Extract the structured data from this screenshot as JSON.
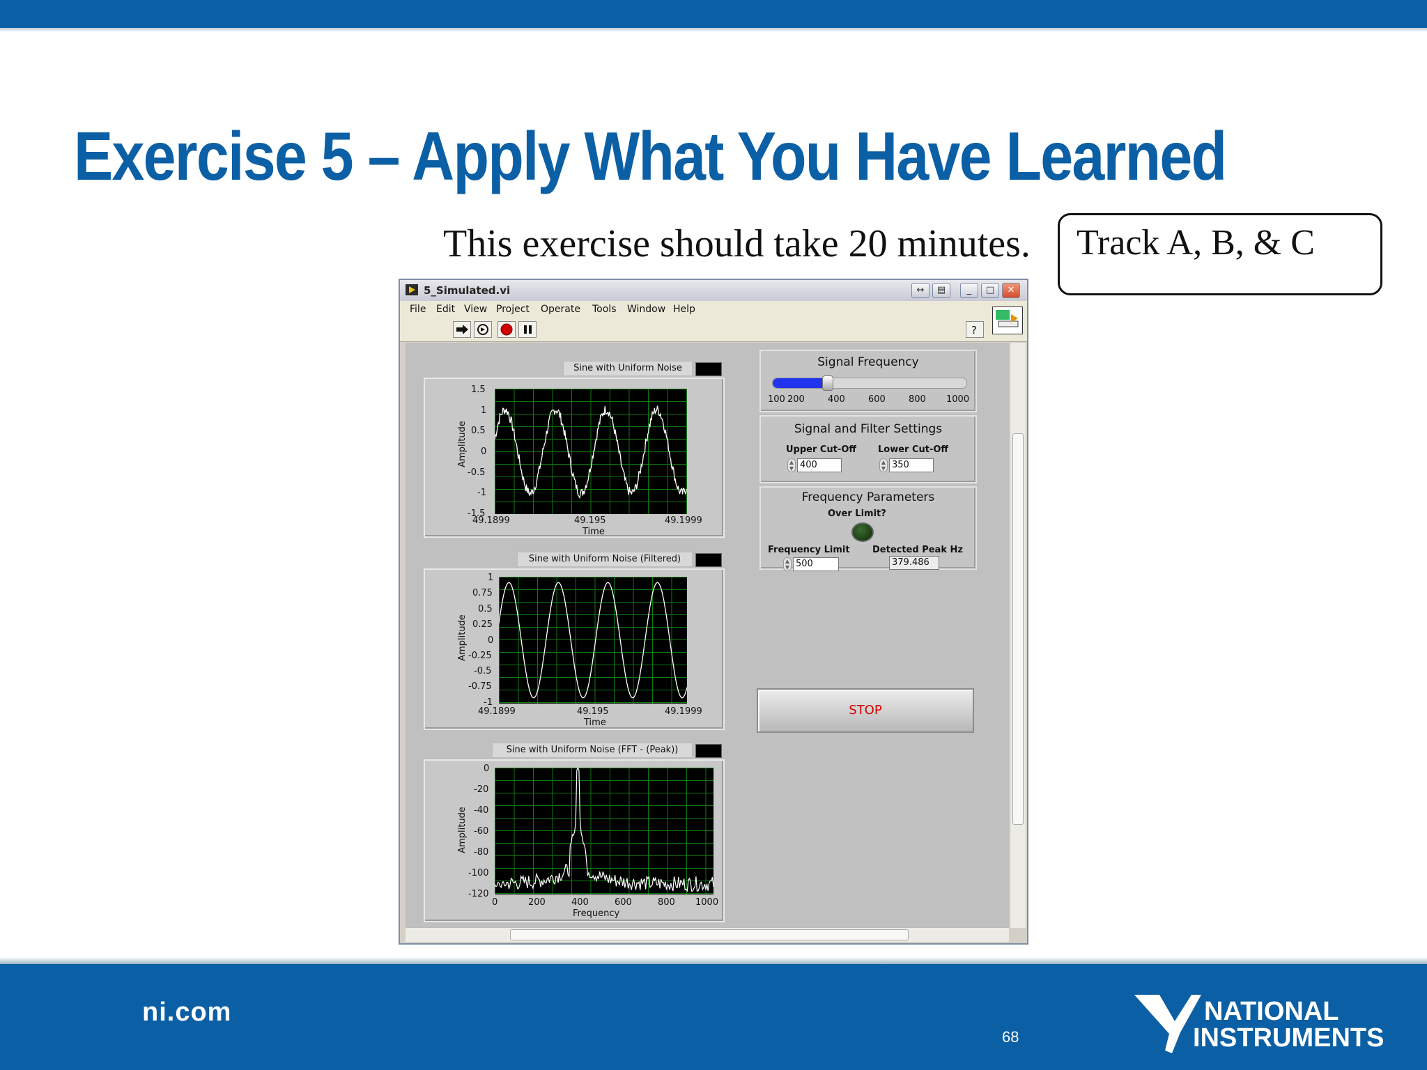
{
  "slide": {
    "title": "Exercise 5 – Apply What You Have Learned",
    "subtitle": "This exercise should take 20 minutes.",
    "track_badge": "Track A, B, & C",
    "footer_site": "ni.com",
    "page_number": "68",
    "logo_line1": "NATIONAL",
    "logo_line2": "INSTRUMENTS",
    "brand_color": "#0b5fa5"
  },
  "window": {
    "title": "5_Simulated.vi",
    "menu": [
      "File",
      "Edit",
      "View",
      "Project",
      "Operate",
      "Tools",
      "Window",
      "Help"
    ],
    "toolbar_icons": [
      "run-arrow-icon",
      "run-continuously-icon",
      "abort-icon",
      "pause-icon"
    ]
  },
  "graphs": {
    "g1": {
      "label": "Sine with Uniform Noise",
      "y_ticks": [
        "1.5",
        "1",
        "0.5",
        "0",
        "-0.5",
        "-1",
        "-1.5"
      ],
      "x_ticks": [
        "49.1899",
        "49.195",
        "49.1999"
      ],
      "xlabel": "Time",
      "ylabel": "Amplitude"
    },
    "g2": {
      "label": "Sine with Uniform Noise (Filtered)",
      "y_ticks": [
        "1",
        "0.75",
        "0.5",
        "0.25",
        "0",
        "-0.25",
        "-0.5",
        "-0.75",
        "-1"
      ],
      "x_ticks": [
        "49.1899",
        "49.195",
        "49.1999"
      ],
      "xlabel": "Time",
      "ylabel": "Amplitude"
    },
    "g3": {
      "label": "Sine with Uniform Noise (FFT - (Peak))",
      "y_ticks": [
        "0",
        "-20",
        "-40",
        "-60",
        "-80",
        "-100",
        "-120"
      ],
      "x_ticks": [
        "0",
        "200",
        "400",
        "600",
        "800",
        "1000"
      ],
      "xlabel": "Frequency",
      "ylabel": "Amplitude"
    }
  },
  "controls": {
    "signal_frequency": {
      "title": "Signal Frequency",
      "ticks": [
        "100",
        "200",
        "400",
        "600",
        "800",
        "1000"
      ],
      "value": 250
    },
    "filter": {
      "title": "Signal and Filter Settings",
      "upper_label": "Upper Cut-Off",
      "upper_value": "400",
      "lower_label": "Lower Cut-Off",
      "lower_value": "350"
    },
    "freq_params": {
      "title": "Frequency Parameters",
      "over_limit_label": "Over Limit?",
      "limit_label": "Frequency Limit",
      "limit_value": "500",
      "peak_label": "Detected Peak Hz",
      "peak_value": "379.486"
    },
    "stop_label": "STOP"
  },
  "chart_data": [
    {
      "type": "line",
      "title": "Sine with Uniform Noise",
      "xlabel": "Time",
      "ylabel": "Amplitude",
      "xlim": [
        49.1899,
        49.1999
      ],
      "ylim": [
        -1.5,
        1.5
      ],
      "series": [
        {
          "name": "Sine with Uniform Noise",
          "cycles": 3.8,
          "amplitude": 1.0,
          "noise": 0.12
        }
      ]
    },
    {
      "type": "line",
      "title": "Sine with Uniform Noise (Filtered)",
      "xlabel": "Time",
      "ylabel": "Amplitude",
      "xlim": [
        49.1899,
        49.1999
      ],
      "ylim": [
        -1,
        1
      ],
      "series": [
        {
          "name": "Sine with Uniform Noise (Filtered)",
          "cycles": 3.8,
          "amplitude": 1.0,
          "noise": 0
        }
      ]
    },
    {
      "type": "line",
      "title": "Sine with Uniform Noise (FFT - (Peak))",
      "xlabel": "Frequency",
      "ylabel": "Amplitude",
      "xlim": [
        0,
        1000
      ],
      "ylim": [
        -120,
        0
      ],
      "series": [
        {
          "name": "Sine with Uniform Noise (FFT - (Peak))",
          "peak_x": 380,
          "peak_y": 0,
          "floor": -110
        }
      ]
    }
  ]
}
